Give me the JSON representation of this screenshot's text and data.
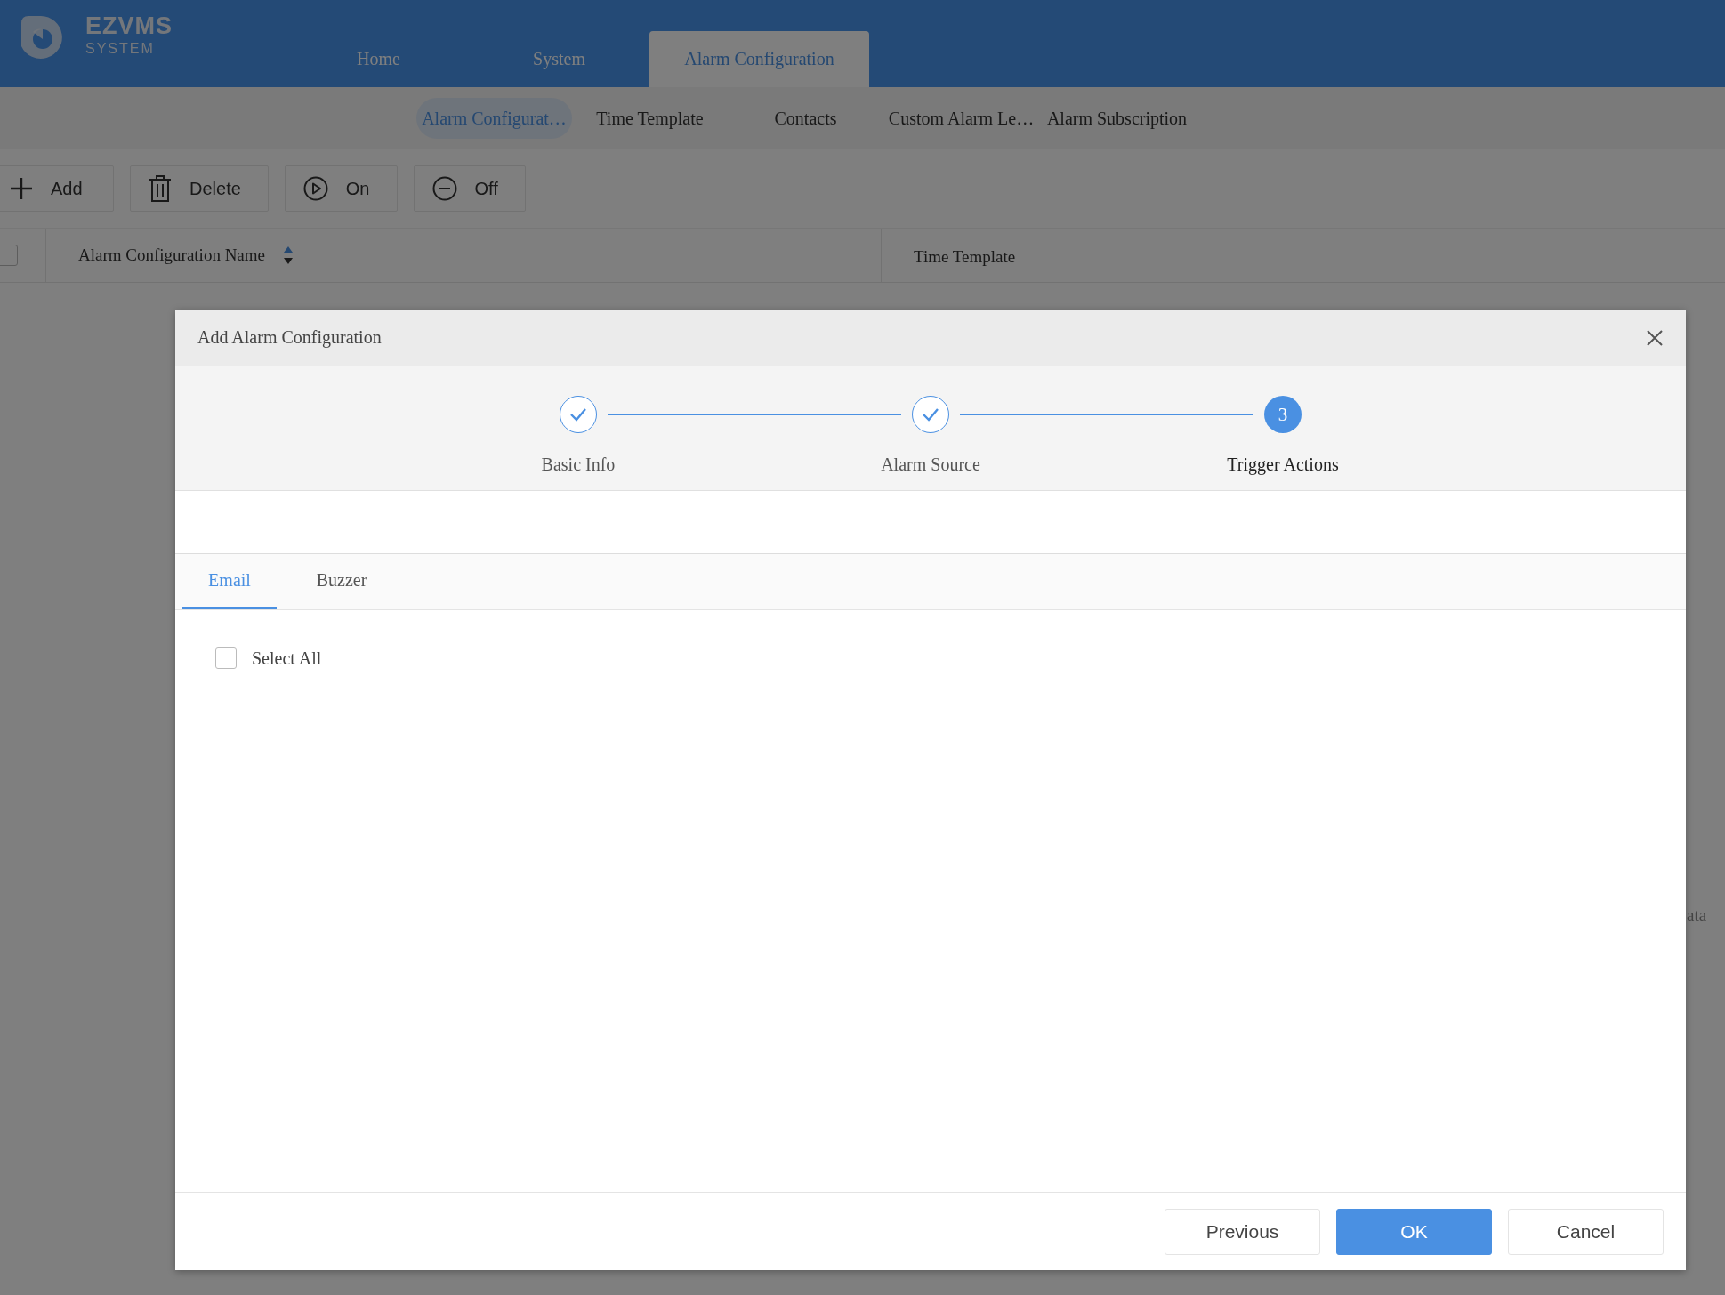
{
  "logo": {
    "name": "EZVMS",
    "subtitle": "SYSTEM"
  },
  "nav": [
    {
      "label": "Home",
      "selected": false
    },
    {
      "label": "System",
      "selected": false
    },
    {
      "label": "Alarm Configuration",
      "selected": true
    }
  ],
  "subnav": [
    {
      "label": "Alarm Configurat…",
      "selected": true
    },
    {
      "label": "Time Template",
      "selected": false
    },
    {
      "label": "Contacts",
      "selected": false
    },
    {
      "label": "Custom Alarm Le…",
      "selected": false
    },
    {
      "label": "Alarm Subscription",
      "selected": false
    }
  ],
  "toolbar": [
    {
      "label": "Add",
      "kind": "plus"
    },
    {
      "label": "Delete",
      "kind": "trash"
    },
    {
      "label": "On",
      "kind": "play"
    },
    {
      "label": "Off",
      "kind": "minus"
    }
  ],
  "table": {
    "header_checked": false,
    "columns": [
      {
        "label": "Alarm Configuration Name",
        "sortable": true
      },
      {
        "label": "Time Template",
        "sortable": false
      }
    ],
    "empty_text": "ata"
  },
  "dialog": {
    "title": "Add Alarm Configuration",
    "steps": [
      {
        "label": "Basic Info",
        "completed": true
      },
      {
        "label": "Alarm Source",
        "completed": true
      },
      {
        "label": "Trigger Actions",
        "completed": false,
        "number": "3"
      }
    ],
    "tabs": [
      {
        "label": "Email",
        "selected": true
      },
      {
        "label": "Buzzer",
        "selected": false
      }
    ],
    "select_all": {
      "label": "Select All",
      "checked": false
    },
    "buttons": [
      {
        "label": "Previous",
        "kind": "default"
      },
      {
        "label": "OK",
        "kind": "primary"
      },
      {
        "label": "Cancel",
        "kind": "default"
      }
    ]
  }
}
